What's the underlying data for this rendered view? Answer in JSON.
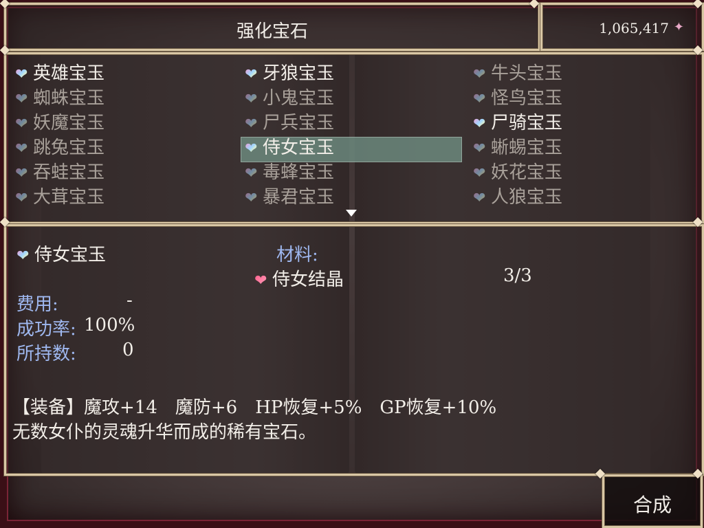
{
  "title": "强化宝石",
  "gold": "1,065,417",
  "gem_list": [
    {
      "label": "英雄宝玉",
      "state": "bright"
    },
    {
      "label": "牙狼宝玉",
      "state": "bright"
    },
    {
      "label": "牛头宝玉",
      "state": "dim"
    },
    {
      "label": "蜘蛛宝玉",
      "state": "dim"
    },
    {
      "label": "小鬼宝玉",
      "state": "dim"
    },
    {
      "label": "怪鸟宝玉",
      "state": "dim"
    },
    {
      "label": "妖魔宝玉",
      "state": "dim"
    },
    {
      "label": "尸兵宝玉",
      "state": "dim"
    },
    {
      "label": "尸骑宝玉",
      "state": "bright"
    },
    {
      "label": "跳兔宝玉",
      "state": "dim"
    },
    {
      "label": "侍女宝玉",
      "state": "selected"
    },
    {
      "label": "蜥蜴宝玉",
      "state": "dim"
    },
    {
      "label": "吞蛙宝玉",
      "state": "dim"
    },
    {
      "label": "毒蜂宝玉",
      "state": "dim"
    },
    {
      "label": "妖花宝玉",
      "state": "dim"
    },
    {
      "label": "大茸宝玉",
      "state": "dim"
    },
    {
      "label": "暴君宝玉",
      "state": "dim"
    },
    {
      "label": "人狼宝玉",
      "state": "dim"
    }
  ],
  "detail": {
    "name": "侍女宝玉",
    "materials_label": "材料:",
    "material_name": "侍女结晶",
    "material_count": "3/3",
    "cost_label": "费用:",
    "cost_value": "-",
    "rate_label": "成功率:",
    "rate_value": "100%",
    "owned_label": "所持数:",
    "owned_value": "0",
    "effect": "【装备】魔攻+14　魔防+6　HP恢复+5%　GP恢复+10%",
    "description": "无数女仆的灵魂升华而成的稀有宝石。"
  },
  "command": {
    "label": "合成"
  },
  "colors": {
    "selected_highlight": "#6f8e82",
    "label_blue": "#9fb8f0",
    "frame_gold": "#d9c7a5"
  }
}
